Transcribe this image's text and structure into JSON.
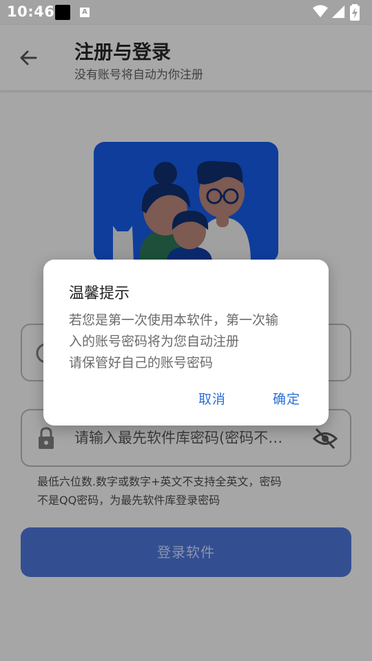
{
  "status_bar": {
    "time": "10:46",
    "icons": [
      "notification-square-icon",
      "a-notification-icon",
      "wifi-icon",
      "cellular-signal-icon",
      "battery-charging-icon"
    ]
  },
  "app_bar": {
    "title": "注册与登录",
    "subtitle": "没有账号将自动为你注册",
    "back_icon": "arrow-back-icon"
  },
  "form": {
    "account_icon": "person-icon",
    "password_icon": "lock-icon",
    "password_placeholder": "请输入最先软件库密码(密码不是QQ密码)",
    "visibility_icon": "visibility-off-icon",
    "hint_line1": "最低六位数.数字或数字+英文不支持全英文，密码",
    "hint_line2": "不是QQ密码，为最先软件库登录密码",
    "login_button": "登录软件"
  },
  "dialog": {
    "title": "温馨提示",
    "body_line1": "若您是第一次使用本软件，第一次输",
    "body_line2": "入的账号密码将为您自动注册",
    "body_line3": "请保管好自己的账号密码",
    "cancel_label": "取消",
    "confirm_label": "确定"
  },
  "colors": {
    "scrim_background": "#a6a6a6",
    "primary_button": "#344f91",
    "dialog_action": "#2b6fd6",
    "hero_background": "#0f3d9b"
  }
}
